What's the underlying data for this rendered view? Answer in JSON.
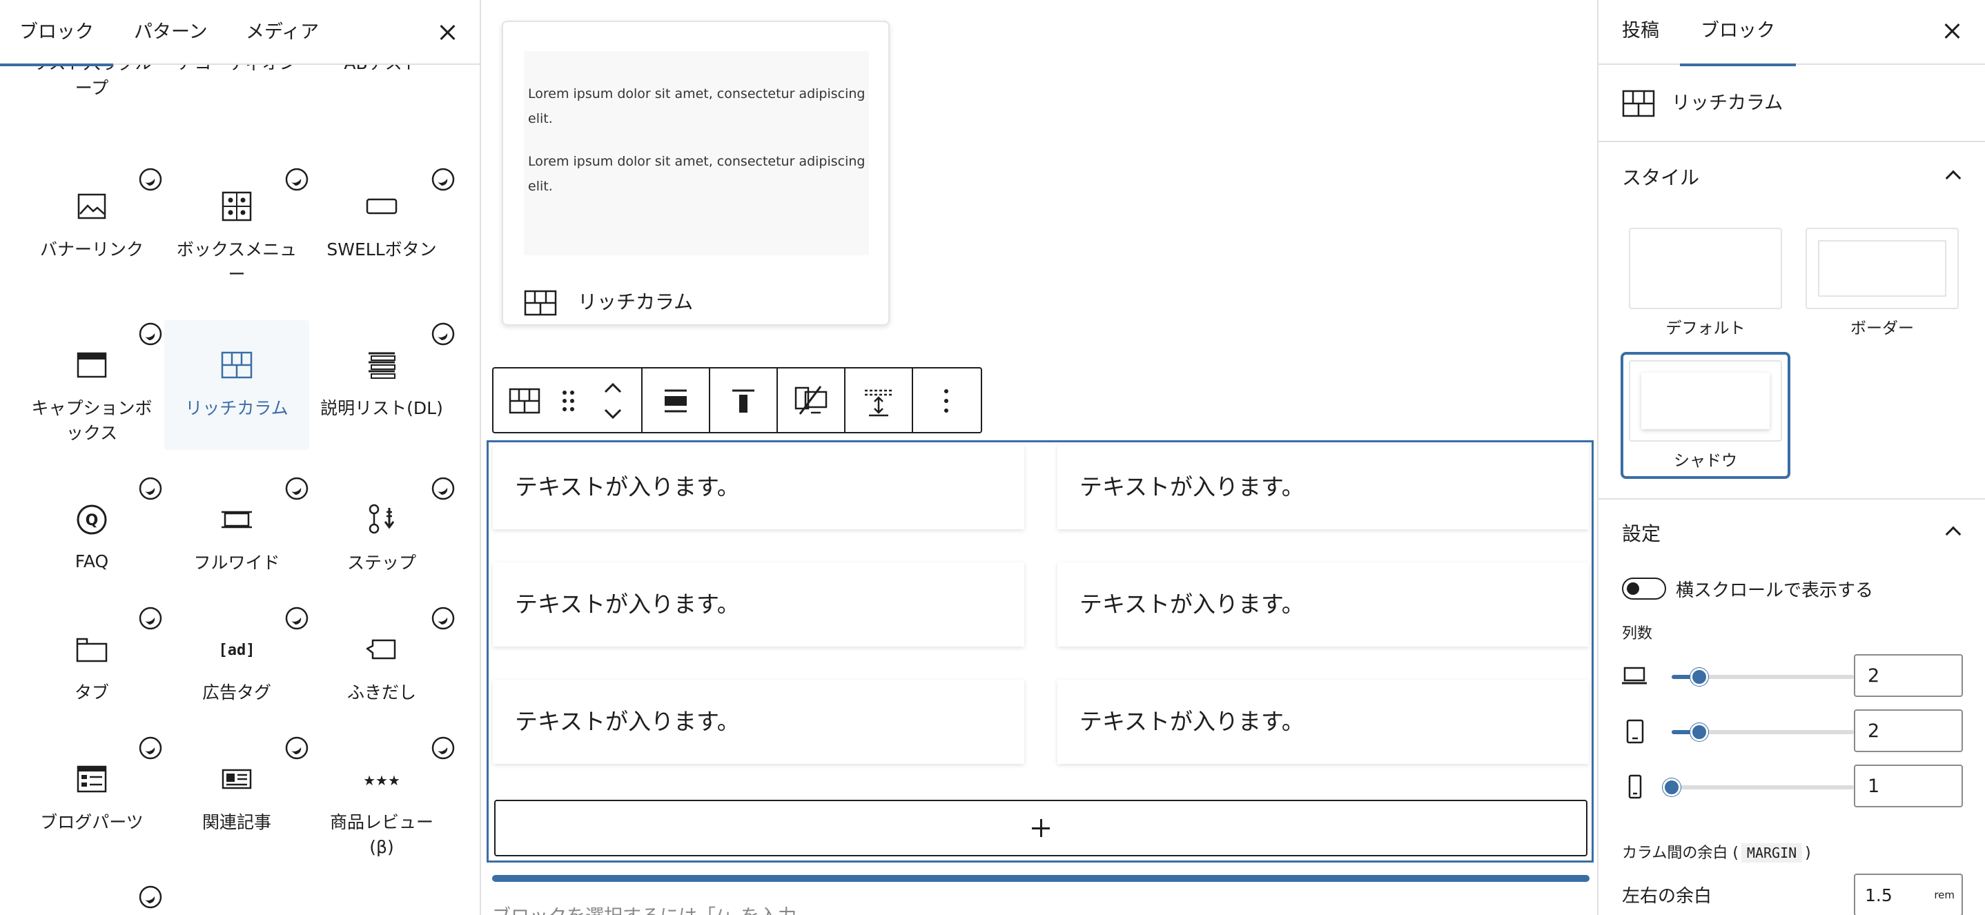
{
  "inserter": {
    "tabs": [
      "ブロック",
      "パターン",
      "メディア"
    ],
    "close_label": "",
    "partial_row": [
      "リスト入りグル\nープ",
      "アコーディオン",
      "ABテスト"
    ],
    "blocks": [
      {
        "label": "バナーリンク",
        "icon": "banner-link-icon"
      },
      {
        "label": "ボックスメニュ\nー",
        "icon": "box-menu-icon"
      },
      {
        "label": "SWELLボタン",
        "icon": "swell-button-icon"
      },
      {
        "label": "キャプションボ\nックス",
        "icon": "caption-box-icon"
      },
      {
        "label": "リッチカラム",
        "icon": "rich-column-icon",
        "selected": true
      },
      {
        "label": "説明リスト(DL)",
        "icon": "description-list-icon"
      },
      {
        "label": "FAQ",
        "icon": "faq-icon"
      },
      {
        "label": "フルワイド",
        "icon": "full-wide-icon"
      },
      {
        "label": "ステップ",
        "icon": "step-icon"
      },
      {
        "label": "タブ",
        "icon": "tab-icon"
      },
      {
        "label": "広告タグ",
        "icon": "ad-tag-icon"
      },
      {
        "label": "ふきだし",
        "icon": "speech-bubble-icon"
      },
      {
        "label": "ブログパーツ",
        "icon": "blog-parts-icon"
      },
      {
        "label": "関連記事",
        "icon": "related-post-icon"
      },
      {
        "label": "商品レビュー\n(β)",
        "icon": "product-review-icon"
      }
    ]
  },
  "preview": {
    "para1": "Lorem ipsum dolor sit amet, consectetur adipiscing elit.",
    "para2": "Lorem ipsum dolor sit amet, consectetur adipiscing elit.",
    "block_name": "リッチカラム"
  },
  "canvas": {
    "cells": [
      "テキストが入ります。",
      "テキストが入ります。",
      "テキストが入ります。",
      "テキストが入ります。",
      "テキストが入ります。",
      "テキストが入ります。"
    ],
    "hint": "ブロックを選択するには「/」を入力"
  },
  "sidebar": {
    "tabs": [
      "投稿",
      "ブロック"
    ],
    "block_name": "リッチカラム",
    "style_title": "スタイル",
    "styles": [
      "デフォルト",
      "ボーダー",
      "シャドウ"
    ],
    "settings_title": "設定",
    "toggle_label": "横スクロールで表示する",
    "columns_label": "列数",
    "columns": [
      {
        "device": "laptop-icon",
        "value": "2",
        "fraction": 0.15
      },
      {
        "device": "tablet-icon",
        "value": "2",
        "fraction": 0.15
      },
      {
        "device": "mobile-icon",
        "value": "1",
        "fraction": 0.0
      }
    ],
    "gap_label_prefix": "カラム間の余白 (",
    "gap_code": "MARGIN",
    "gap_label_suffix": ")",
    "hmargin_label": "左右の余白",
    "hmargin_value": "1.5",
    "hmargin_unit": "rem"
  },
  "colors": {
    "accent": "#3a6ea5",
    "text": "#1e1e1e",
    "border": "#e0e0e0"
  }
}
